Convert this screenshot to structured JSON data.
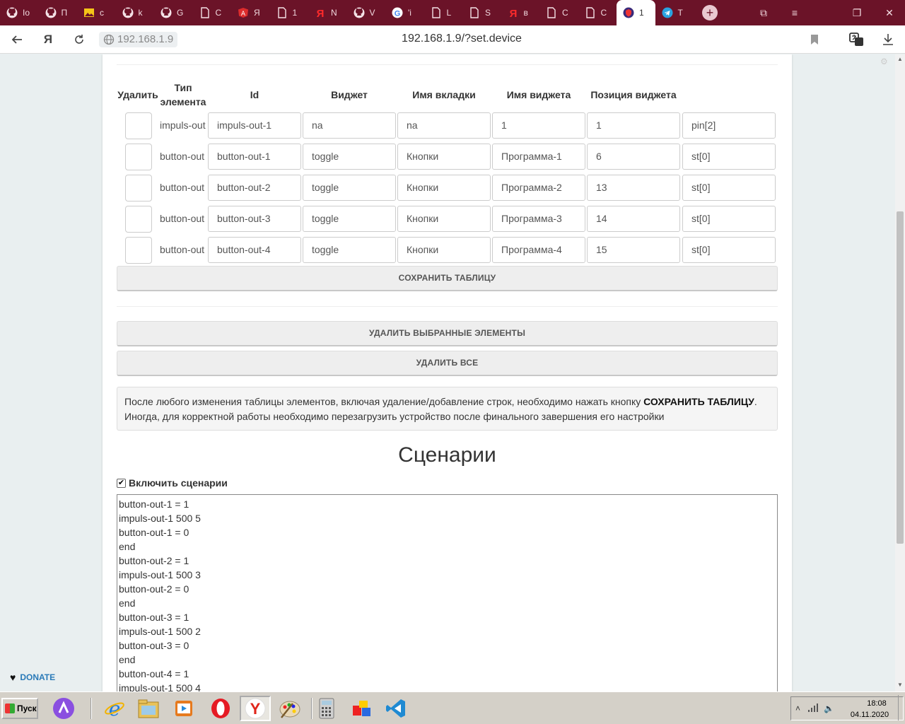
{
  "browser": {
    "tabs": [
      {
        "icon": "github-icon",
        "label": "Io"
      },
      {
        "icon": "github-icon",
        "label": "П"
      },
      {
        "icon": "image-icon",
        "label": "c"
      },
      {
        "icon": "github-icon",
        "label": "k"
      },
      {
        "icon": "github-icon",
        "label": "G"
      },
      {
        "icon": "document-icon",
        "label": "C"
      },
      {
        "icon": "angular-icon",
        "label": "Я"
      },
      {
        "icon": "document-icon",
        "label": "1"
      },
      {
        "icon": "yandex-icon",
        "label": "N"
      },
      {
        "icon": "github-icon",
        "label": "V"
      },
      {
        "icon": "google-icon",
        "label": "'i"
      },
      {
        "icon": "document-icon",
        "label": "L"
      },
      {
        "icon": "document-icon",
        "label": "S"
      },
      {
        "icon": "yandex-icon",
        "label": "в"
      },
      {
        "icon": "document-icon",
        "label": "C"
      },
      {
        "icon": "document-icon",
        "label": "C"
      },
      {
        "icon": "shield-icon",
        "label": "1",
        "active": true
      },
      {
        "icon": "telegram-icon",
        "label": "T"
      }
    ],
    "host": "192.168.1.9",
    "url": "192.168.1.9/?set.device"
  },
  "table": {
    "headers": {
      "delete": "Удалить",
      "type": "Тип элемента",
      "id": "Id",
      "widget": "Виджет",
      "tab_name": "Имя вкладки",
      "widget_name": "Имя виджета",
      "widget_pos": "Позиция виджета"
    },
    "rows": [
      {
        "type": "impuls-out",
        "id": "impuls-out-1",
        "widget": "na",
        "tab": "na",
        "name": "1",
        "pos": "1",
        "pin": "pin[2]"
      },
      {
        "type": "button-out",
        "id": "button-out-1",
        "widget": "toggle",
        "tab": "Кнопки",
        "name": "Программа-1",
        "pos": "6",
        "pin": "st[0]"
      },
      {
        "type": "button-out",
        "id": "button-out-2",
        "widget": "toggle",
        "tab": "Кнопки",
        "name": "Программа-2",
        "pos": "13",
        "pin": "st[0]"
      },
      {
        "type": "button-out",
        "id": "button-out-3",
        "widget": "toggle",
        "tab": "Кнопки",
        "name": "Программа-3",
        "pos": "14",
        "pin": "st[0]"
      },
      {
        "type": "button-out",
        "id": "button-out-4",
        "widget": "toggle",
        "tab": "Кнопки",
        "name": "Программа-4",
        "pos": "15",
        "pin": "st[0]"
      }
    ],
    "save_label": "Сохранить таблицу"
  },
  "actions": {
    "delete_selected": "Удалить выбранные элементы",
    "delete_all": "Удалить все"
  },
  "note": {
    "text_before": "После любого изменения таблицы элементов, включая удаление/добавление строк, необходимо нажать кнопку ",
    "bold": "СОХРАНИТЬ ТАБЛИЦУ",
    "text_after": ".",
    "line2": "Иногда, для корректной работы необходимо перезагрузить устройство после финального завершения его настройки"
  },
  "scenarios": {
    "title": "Сценарии",
    "enable_label": "Включить сценарии",
    "enabled": true,
    "lines": [
      "button-out-1 = 1",
      "impuls-out-1 500 5",
      "button-out-1 = 0",
      "end",
      "button-out-2 = 1",
      "impuls-out-1 500 3",
      "button-out-2 = 0",
      "end",
      "button-out-3 = 1",
      "impuls-out-1 500 2",
      "button-out-3 = 0",
      "end",
      "button-out-4 = 1",
      "impuls-out-1 500 4"
    ]
  },
  "donate_label": "DONATE",
  "taskbar": {
    "start_label": "Пуск",
    "time": "18:08",
    "date": "04.11.2020"
  }
}
